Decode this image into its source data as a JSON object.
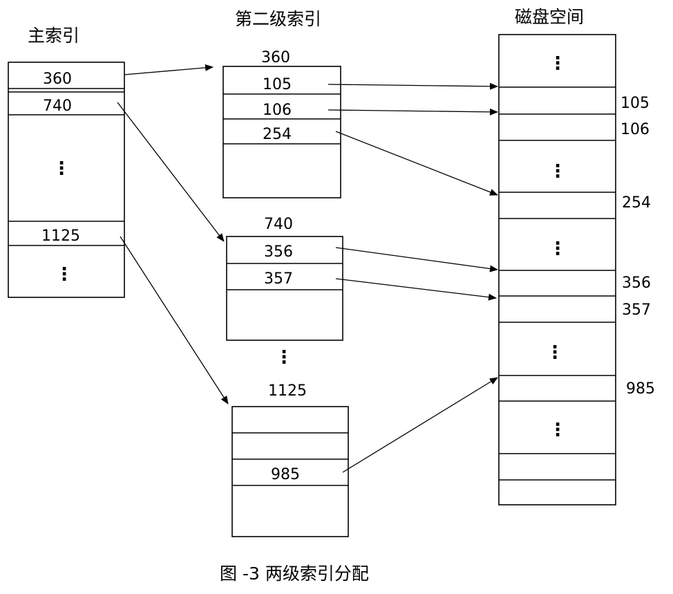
{
  "labels": {
    "main_index": "主索引",
    "second_index": "第二级索引",
    "disk_space": "磁盘空间",
    "caption": "图 -3 两级索引分配"
  },
  "main_index": {
    "entries": [
      "360",
      "740",
      "⋮",
      "1125",
      "⋮"
    ]
  },
  "second_index": {
    "block_360": {
      "label": "360",
      "entries": [
        "105",
        "106",
        "254"
      ]
    },
    "block_740": {
      "label": "740",
      "entries": [
        "356",
        "357"
      ]
    },
    "block_1125": {
      "label": "1125",
      "entries": [
        "985"
      ]
    },
    "gap": "⋮"
  },
  "disk": {
    "addresses": [
      "105",
      "106",
      "254",
      "356",
      "357",
      "985"
    ],
    "dots": "⋮"
  }
}
